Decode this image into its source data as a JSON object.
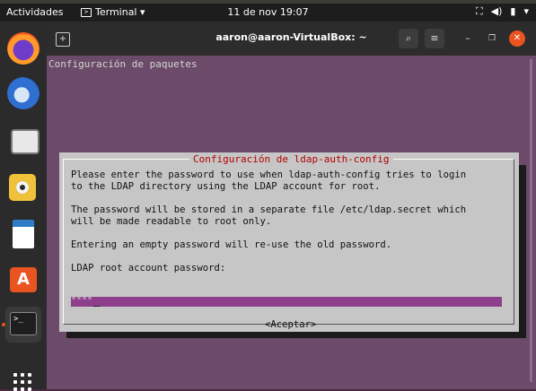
{
  "top_bar": {
    "activities": "Actividades",
    "app_menu": "Terminal ▾",
    "clock": "11 de nov  19:07",
    "tray": [
      "network-icon",
      "volume-icon",
      "battery-icon",
      "power-menu-icon"
    ]
  },
  "dock": {
    "items": [
      "firefox",
      "thunderbird",
      "files",
      "rhythmbox",
      "libreoffice-writer",
      "ubuntu-software",
      "terminal"
    ],
    "terminal_glyph": ">_"
  },
  "terminal": {
    "title": "aaron@aaron-VirtualBox: ~",
    "header_line": "Configuración de paquetes"
  },
  "dialog": {
    "title": "Configuración de ldap-auth-config",
    "line1": "Please enter the password to use when ldap-auth-config tries to login",
    "line2": "to the LDAP directory using the LDAP account for root.",
    "line3": "The password will be stored in a separate file /etc/ldap.secret which",
    "line4": "will be made readable to root only.",
    "line5": "Entering an empty password will re-use the old password.",
    "line6": "LDAP root account password:",
    "password_value": "****",
    "accept_label": "<Aceptar>"
  },
  "colors": {
    "terminal_bg": "#6b4a6a",
    "dialog_bg": "#c6c6c6",
    "dialog_title": "#b30000",
    "input_bg": "#8e3f8c",
    "accent": "#e95420"
  }
}
